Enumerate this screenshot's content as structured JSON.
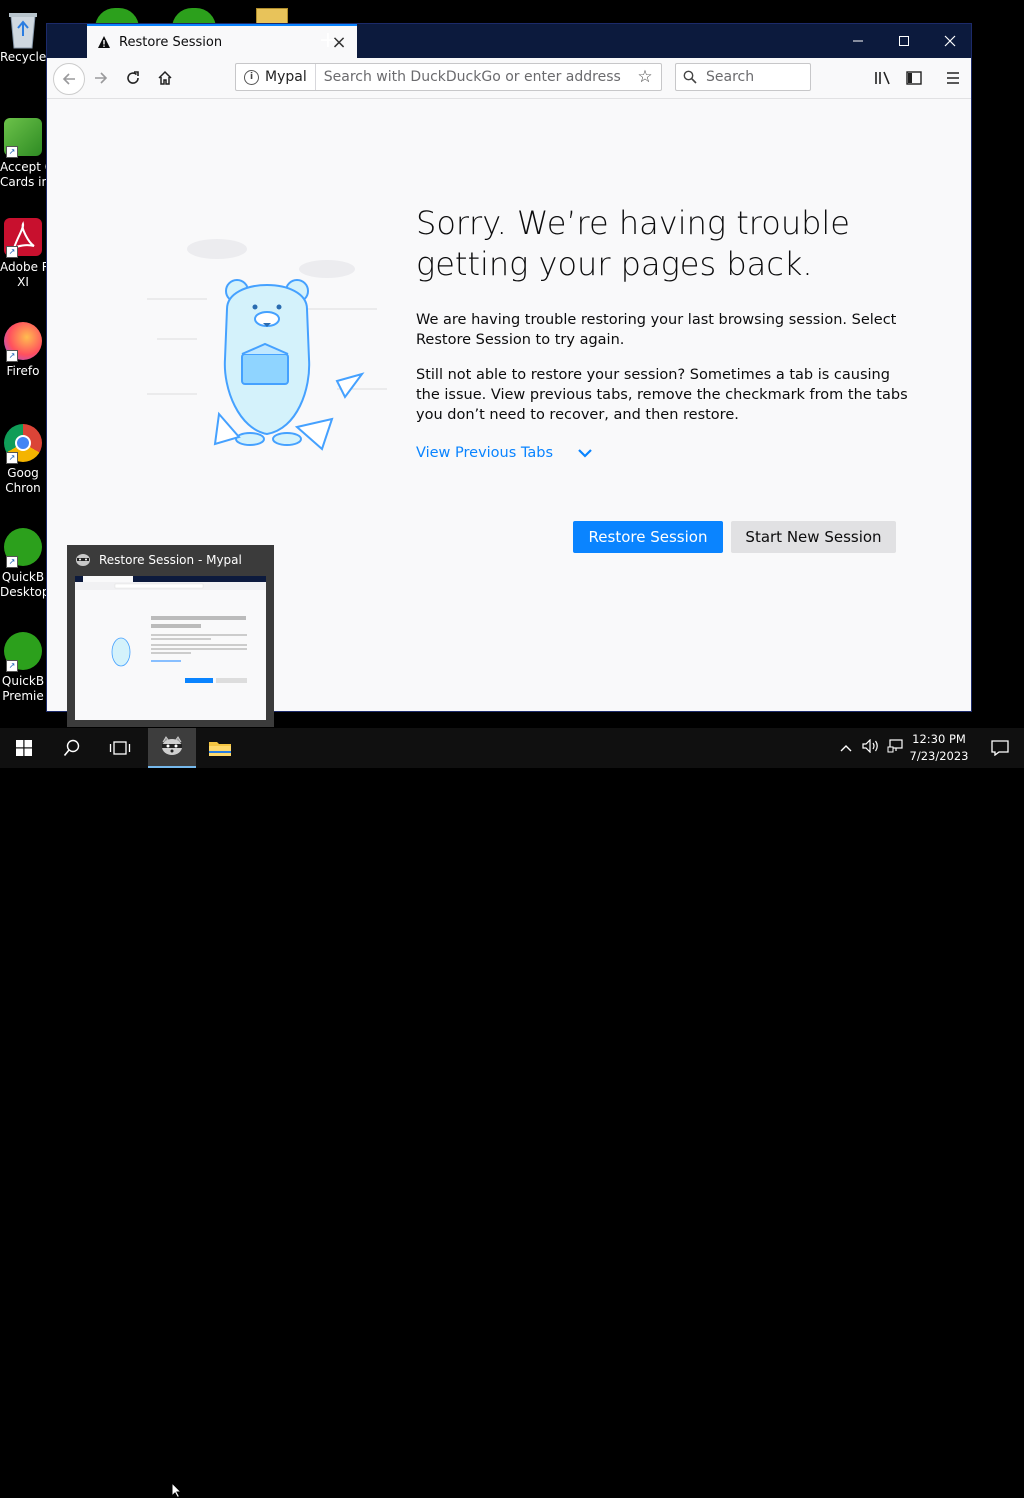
{
  "desktop": {
    "icons": [
      {
        "label": "Recycle",
        "icon": "recycle-bin-icon"
      },
      {
        "label": "Accept C",
        "label2": "Cards in",
        "icon": "accept-cards-icon"
      },
      {
        "label": "Adobe R",
        "label2": "XI",
        "icon": "adobe-reader-icon"
      },
      {
        "label": "Firefo",
        "icon": "firefox-icon"
      },
      {
        "label": "Goog",
        "label2": "Chron",
        "icon": "chrome-icon"
      },
      {
        "label": "QuickB",
        "label2": "Desktop",
        "icon": "quickbooks-desktop-icon"
      },
      {
        "label": "QuickB",
        "label2": "Premie",
        "icon": "quickbooks-premier-icon"
      }
    ]
  },
  "browser": {
    "tab_title": "Restore Session",
    "new_tab_label": "+",
    "identity_label": "Mypal",
    "url_placeholder": "Search with DuckDuckGo or enter address",
    "search_placeholder": "Search"
  },
  "page": {
    "headline": "Sorry. We’re having trouble getting your pages back.",
    "paragraph1": "We are having trouble restoring your last browsing session. Select Restore Session to try again.",
    "paragraph2": "Still not able to restore your session? Sometimes a tab is causing the issue. View previous tabs, remove the checkmark from the tabs you don’t need to recover, and then restore.",
    "view_previous_tabs": "View Previous Tabs",
    "restore_button": "Restore Session",
    "new_session_button": "Start New Session"
  },
  "preview": {
    "title": "Restore Session - Mypal"
  },
  "taskbar": {
    "time": "12:30 PM",
    "date": "7/23/2023"
  },
  "colors": {
    "accent": "#0a84ff",
    "titlebar": "#0c1a3d",
    "taskbar": "#101010"
  }
}
